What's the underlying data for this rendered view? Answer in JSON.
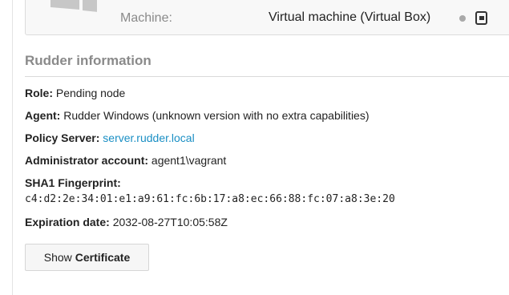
{
  "machine": {
    "label": "Machine:",
    "value": "Virtual machine (Virtual Box)"
  },
  "rudder_info": {
    "title": "Rudder information",
    "role_label": "Role:",
    "role_value": "Pending node",
    "agent_label": "Agent:",
    "agent_value": "Rudder Windows (unknown version with no extra capabilities)",
    "policy_server_label": "Policy Server:",
    "policy_server_value": "server.rudder.local",
    "admin_label": "Administrator account:",
    "admin_value": "agent1\\vagrant",
    "fingerprint_label": "SHA1 Fingerprint:",
    "fingerprint_value": "c4:d2:2e:34:01:e1:a9:61:fc:6b:17:a8:ec:66:88:fc:07:a8:3e:20",
    "expiration_label": "Expiration date:",
    "expiration_value": "2032-08-27T10:05:58Z"
  },
  "button": {
    "show_label": "Show",
    "certificate_label": "Certificate"
  },
  "colors": {
    "link": "#1a8fc4",
    "muted": "#8a8a8a",
    "status_dot": "#a9a9a9"
  },
  "icons": {
    "os": "windows-logo-icon",
    "status": "status-dot-icon",
    "vm": "virtual-machine-icon"
  }
}
